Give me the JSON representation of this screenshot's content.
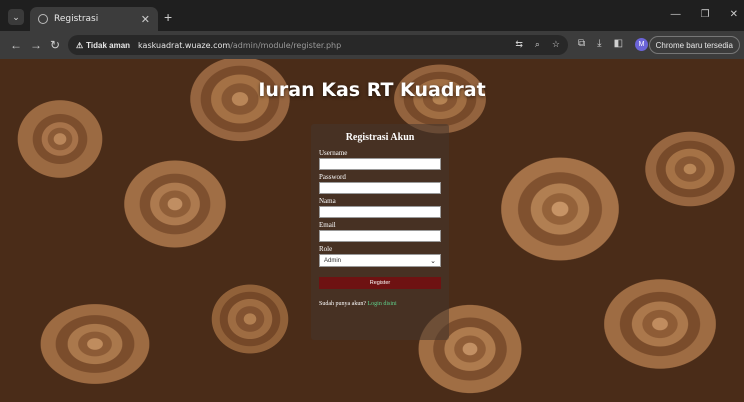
{
  "browser": {
    "tab_title": "Registrasi",
    "security_label": "Tidak aman",
    "url_host": "kaskuadrat.wuaze.com",
    "url_path": "/admin/module/register.php",
    "update_label": "Chrome baru tersedia",
    "avatar_initial": "M"
  },
  "page": {
    "heading": "Iuran Kas RT Kuadrat"
  },
  "form": {
    "title": "Registrasi Akun",
    "username_label": "Username",
    "password_label": "Password",
    "nama_label": "Nama",
    "email_label": "Email",
    "role_label": "Role",
    "role_selected": "Admin",
    "register_label": "Register",
    "login_prompt": "Sudah punya akun?",
    "login_link": "Login disini"
  },
  "colors": {
    "register_button": "#6e1212",
    "login_link": "#5fd08a"
  }
}
